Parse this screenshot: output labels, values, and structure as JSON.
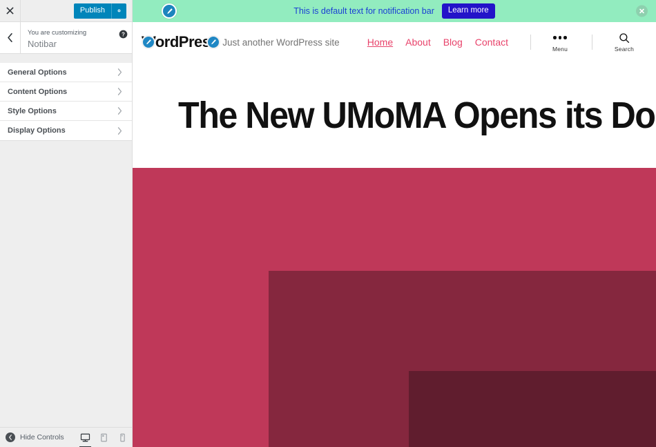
{
  "customizer": {
    "close_label": "Close",
    "publish_label": "Publish",
    "gear_label": "Publish settings",
    "back_label": "Back",
    "subtitle": "You are customizing",
    "title": "Notibar",
    "help_label": "Help",
    "panels": [
      {
        "label": "General Options"
      },
      {
        "label": "Content Options"
      },
      {
        "label": "Style Options"
      },
      {
        "label": "Display Options"
      }
    ],
    "footer": {
      "hide_controls_label": "Hide Controls",
      "devices": [
        {
          "name": "desktop",
          "label": "Enter desktop preview mode",
          "active": true
        },
        {
          "name": "tablet",
          "label": "Enter tablet preview mode",
          "active": false
        },
        {
          "name": "mobile",
          "label": "Enter mobile preview mode",
          "active": false
        }
      ]
    },
    "colors": {
      "publish_button": "#0085ba",
      "panel_bg": "#eeeeee",
      "list_bg": "#ffffff"
    }
  },
  "preview": {
    "notification_bar": {
      "text": "This is default text for notification bar",
      "button_label": "Learn more",
      "background": "#92ecbf",
      "text_color": "#1a3fd4",
      "button_background": "#2313c9",
      "close_label": "Close notification bar"
    },
    "site_header": {
      "title": "WordPress",
      "tagline": "Just another WordPress site",
      "nav": [
        {
          "label": "Home",
          "active": true
        },
        {
          "label": "About",
          "active": false
        },
        {
          "label": "Blog",
          "active": false
        },
        {
          "label": "Contact",
          "active": false
        }
      ],
      "nav_color": "#e8426a",
      "menu_label": "Menu",
      "search_label": "Search"
    },
    "hero": {
      "title": "The New UMoMA Opens its Doors",
      "image_colors": [
        "#bf3859",
        "#85273e",
        "#601d2e"
      ]
    }
  }
}
